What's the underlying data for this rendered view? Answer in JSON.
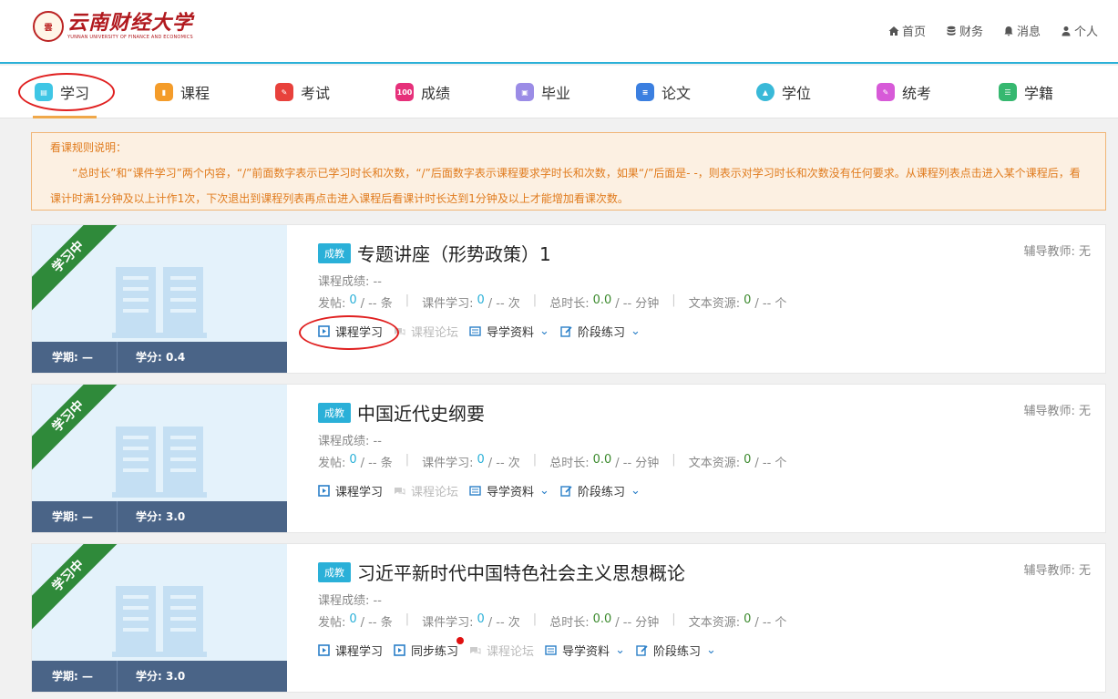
{
  "logo": {
    "seal": "雲",
    "cn": "云南财经大学",
    "en": "YUNNAN UNIVERSITY OF FINANCE AND ECONOMICS"
  },
  "topnav": [
    {
      "label": "首页",
      "icon": "home-icon"
    },
    {
      "label": "财务",
      "icon": "database-icon"
    },
    {
      "label": "消息",
      "icon": "bell-icon"
    },
    {
      "label": "个人",
      "icon": "user-icon"
    }
  ],
  "tabs": [
    {
      "label": "学习",
      "icon": "book-open-icon",
      "color": "#3fc6e5",
      "active": true
    },
    {
      "label": "课程",
      "icon": "bookmark-icon",
      "color": "#f49c2a"
    },
    {
      "label": "考试",
      "icon": "pencil-icon",
      "color": "#e8413c"
    },
    {
      "label": "成绩",
      "icon": "score-100-icon",
      "color": "#e6307a"
    },
    {
      "label": "毕业",
      "icon": "certificate-icon",
      "color": "#9b8ce6"
    },
    {
      "label": "论文",
      "icon": "document-icon",
      "color": "#3b7fe0"
    },
    {
      "label": "学位",
      "icon": "graduation-cap-icon",
      "color": "#39b9d8"
    },
    {
      "label": "统考",
      "icon": "exam-icon",
      "color": "#d75ad8"
    },
    {
      "label": "学籍",
      "icon": "server-icon",
      "color": "#36b870"
    }
  ],
  "notice": {
    "title": "看课规则说明：",
    "body": "“总时长”和“课件学习”两个内容，“/”前面数字表示已学习时长和次数，“/”后面数字表示课程要求学时长和次数，如果“/”后面是- -，则表示对学习时长和次数没有任何要求。从课程列表点击进入某个课程后，看课计时满1分钟及以上计作1次，下次退出到课程列表再点击进入课程后看课计时长达到1分钟及以上才能增加看课次数。"
  },
  "courses": [
    {
      "status": "学习中",
      "term": "学期: —",
      "credit": "学分: 0.4",
      "badge": "成教",
      "title": "专题讲座（形势政策）1",
      "tutor": "辅导教师: 无",
      "score": "课程成绩: --",
      "posts_label": "发帖:",
      "posts_val": "0",
      "posts_req": "/ -- 条",
      "cw_label": "课件学习:",
      "cw_val": "0",
      "cw_req": "/ -- 次",
      "time_label": "总时长:",
      "time_val": "0.0",
      "time_req": "/ -- 分钟",
      "res_label": "文本资源:",
      "res_val": "0",
      "res_req": "/ -- 个",
      "actions": [
        "课程学习",
        "课程论坛",
        "导学资料",
        "阶段练习"
      ]
    },
    {
      "status": "学习中",
      "term": "学期: —",
      "credit": "学分: 3.0",
      "badge": "成教",
      "title": "中国近代史纲要",
      "tutor": "辅导教师: 无",
      "score": "课程成绩: --",
      "posts_label": "发帖:",
      "posts_val": "0",
      "posts_req": "/ -- 条",
      "cw_label": "课件学习:",
      "cw_val": "0",
      "cw_req": "/ -- 次",
      "time_label": "总时长:",
      "time_val": "0.0",
      "time_req": "/ -- 分钟",
      "res_label": "文本资源:",
      "res_val": "0",
      "res_req": "/ -- 个",
      "actions": [
        "课程学习",
        "课程论坛",
        "导学资料",
        "阶段练习"
      ]
    },
    {
      "status": "学习中",
      "term": "学期: —",
      "credit": "学分: 3.0",
      "badge": "成教",
      "title": "习近平新时代中国特色社会主义思想概论",
      "tutor": "辅导教师: 无",
      "score": "课程成绩: --",
      "posts_label": "发帖:",
      "posts_val": "0",
      "posts_req": "/ -- 条",
      "cw_label": "课件学习:",
      "cw_val": "0",
      "cw_req": "/ -- 次",
      "time_label": "总时长:",
      "time_val": "0.0",
      "time_req": "/ -- 分钟",
      "res_label": "文本资源:",
      "res_val": "0",
      "res_req": "/ -- 个",
      "actions": [
        "课程学习",
        "同步练习",
        "课程论坛",
        "导学资料",
        "阶段练习"
      ]
    }
  ]
}
